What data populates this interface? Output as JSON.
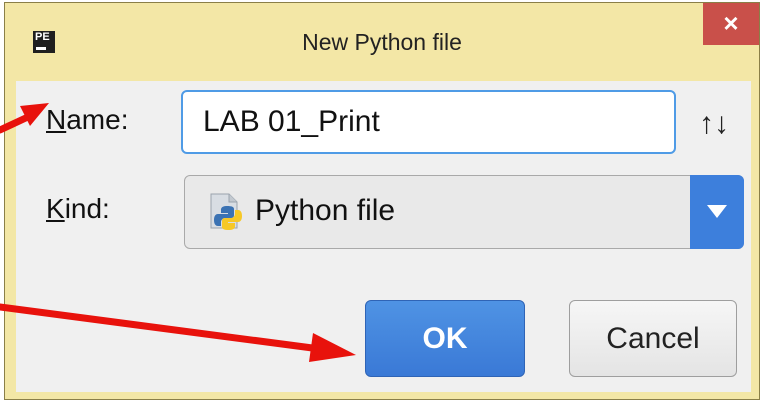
{
  "window": {
    "title": "New Python file",
    "app_icon_text": "PE",
    "close_glyph": "×"
  },
  "form": {
    "name_label_accel": "N",
    "name_label_rest": "ame:",
    "name_value": "LAB 01_Print",
    "sort_glyph": "↑↓",
    "kind_label_accel": "K",
    "kind_label_rest": "ind:",
    "kind_value": "Python file",
    "kind_icon": "python-file-icon"
  },
  "buttons": {
    "ok_label": "OK",
    "cancel_label": "Cancel"
  },
  "annotations": {
    "arrow_color": "#e8120c"
  }
}
